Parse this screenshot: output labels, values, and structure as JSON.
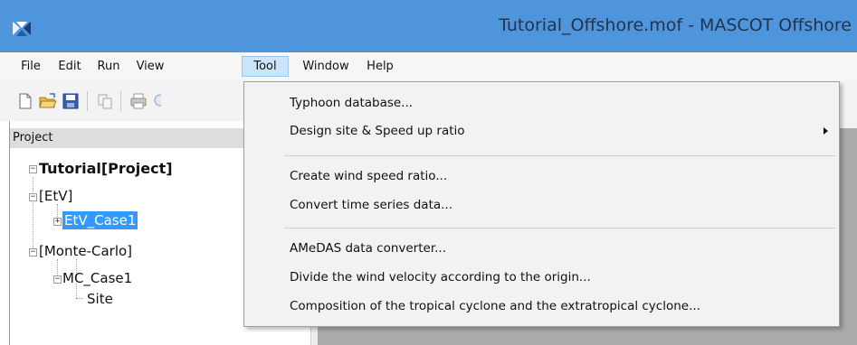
{
  "window": {
    "title": "Tutorial_Offshore.mof - MASCOT Offshore",
    "app_icon": "mascot-app-icon",
    "titlebar_color": "#4f95dc"
  },
  "menubar": {
    "items": [
      {
        "label": "File"
      },
      {
        "label": "Edit"
      },
      {
        "label": "Run"
      },
      {
        "label": "View"
      },
      {
        "label": "Tool",
        "active": true
      },
      {
        "label": "Window"
      },
      {
        "label": "Help"
      }
    ],
    "active_color": "#cce4f7"
  },
  "toolbar": {
    "buttons": [
      "new-file-icon",
      "open-folder-icon",
      "save-icon",
      "copy-icon",
      "print-icon"
    ]
  },
  "project_pane": {
    "header": "Project",
    "tree": {
      "root": "Tutorial[Project]",
      "etv": "[EtV]",
      "etv_case1": "EtV_Case1",
      "monte_carlo": "[Monte-Carlo]",
      "mc_case1": "MC_Case1",
      "site": "Site"
    },
    "selection_color": "#3399ff"
  },
  "tool_menu": {
    "items": [
      {
        "label": "Typhoon database..."
      },
      {
        "label": "Design site & Speed up ratio",
        "submenu": true
      },
      {
        "label": "Create wind speed ratio..."
      },
      {
        "label": "Convert time series data..."
      },
      {
        "label": "AMeDAS data converter..."
      },
      {
        "label": "Divide the wind velocity according to the origin..."
      },
      {
        "label": "Composition of the tropical cyclone and the extratropical cyclone..."
      }
    ]
  },
  "workspace": {
    "background_color": "#ababab"
  }
}
